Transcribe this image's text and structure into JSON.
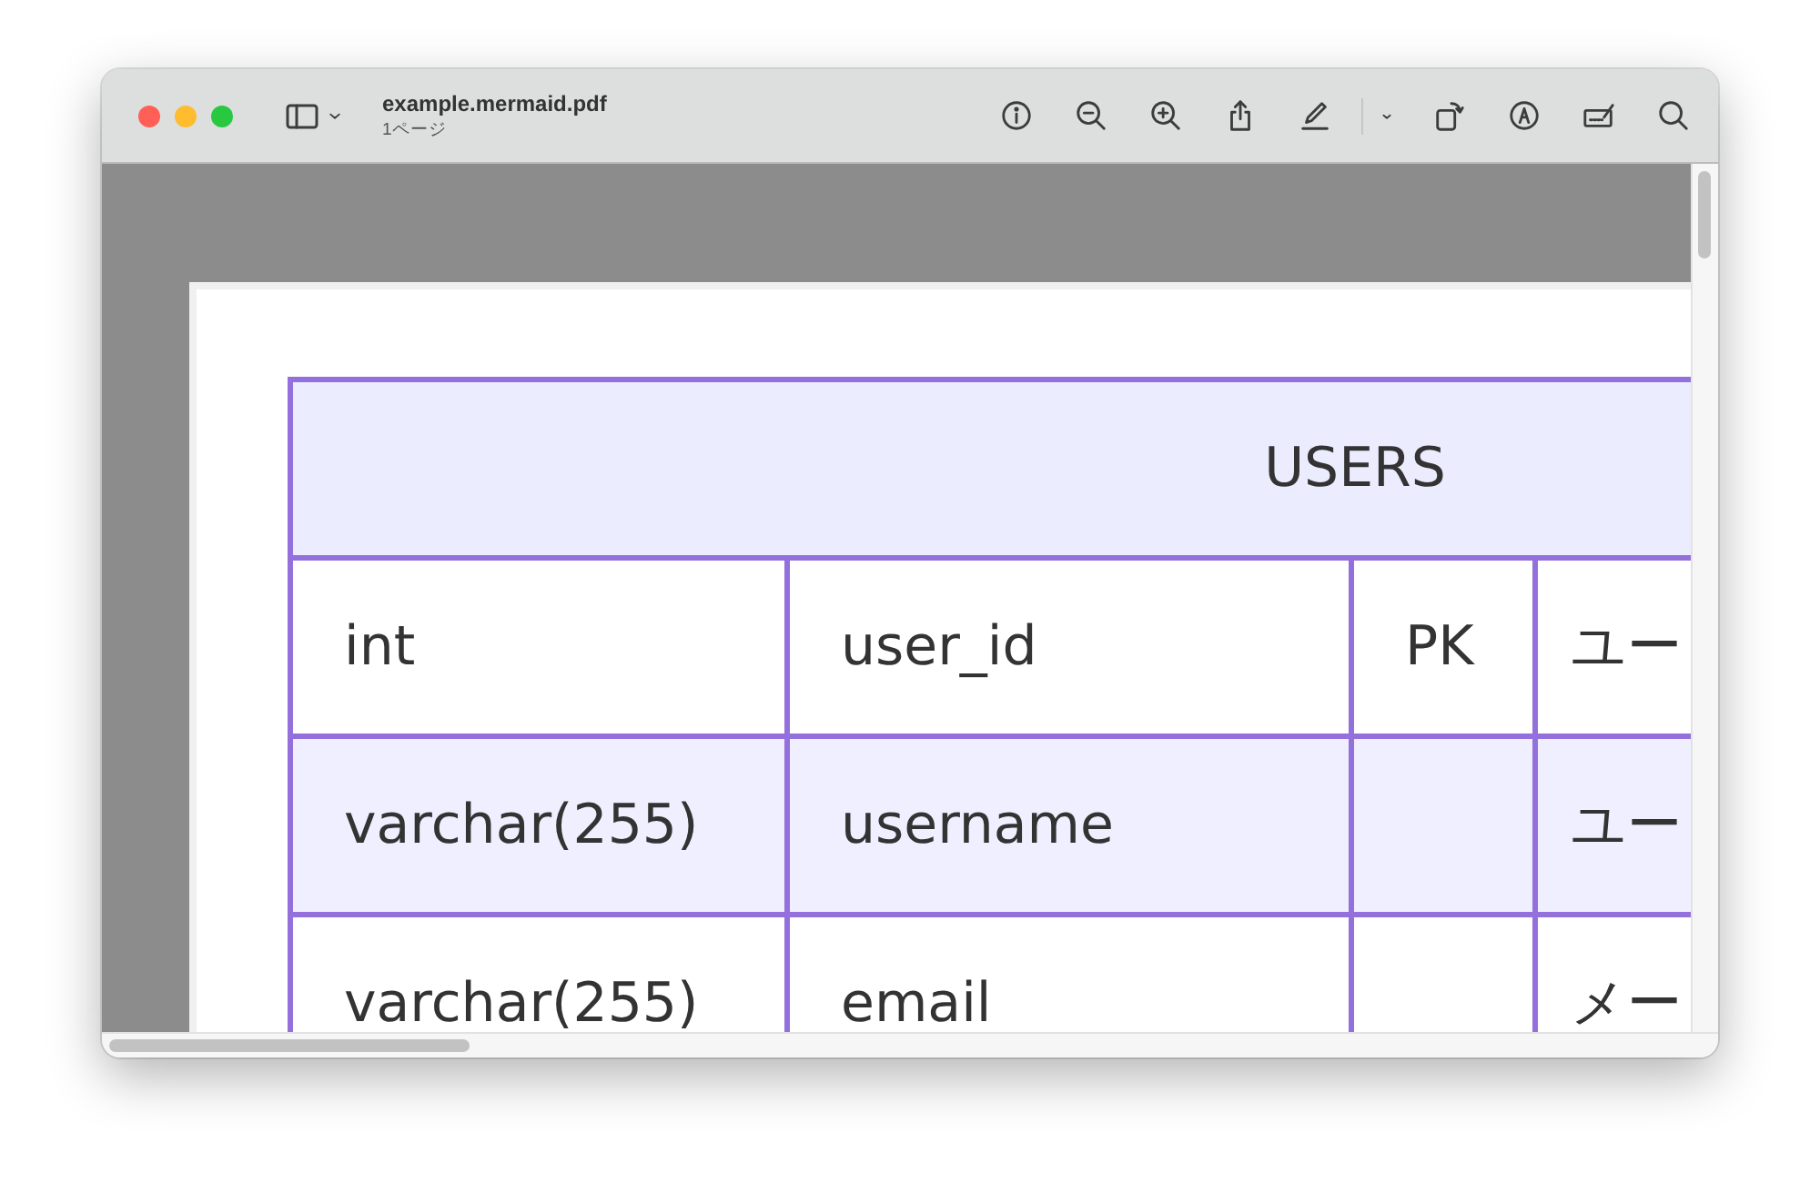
{
  "window": {
    "title": "example.mermaid.pdf",
    "subtitle": "1ページ"
  },
  "table": {
    "title": "USERS",
    "rows": [
      {
        "cells": [
          "int",
          "user_id",
          "PK",
          "ユー"
        ]
      },
      {
        "cells": [
          "varchar(255)",
          "username",
          "",
          "ユー"
        ]
      },
      {
        "cells": [
          "varchar(255)",
          "email",
          "",
          "メー"
        ]
      }
    ]
  }
}
